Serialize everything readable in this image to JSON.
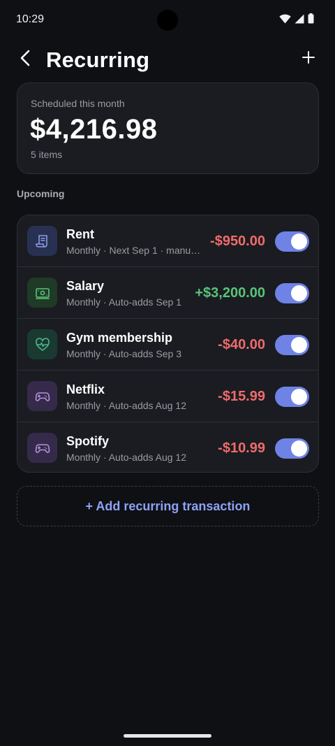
{
  "status_bar": {
    "time": "10:29"
  },
  "app_bar": {
    "title": "Recurring"
  },
  "summary": {
    "label": "Scheduled this month",
    "amount": "$4,216.98",
    "count": "5 items"
  },
  "section": {
    "heading": "Upcoming"
  },
  "items": [
    {
      "name": "Rent",
      "subtitle": "Monthly · Next Sep 1 · manu…",
      "amount": "-$950.00",
      "type": "expense",
      "icon": "receipt-icon",
      "icon_bg": "#283152",
      "icon_color": "#8a9ce8",
      "enabled": true
    },
    {
      "name": "Salary",
      "subtitle": "Monthly · Auto-adds Sep 1",
      "amount": "+$3,200.00",
      "type": "income",
      "icon": "banknote-icon",
      "icon_bg": "#1f3a26",
      "icon_color": "#59c47a",
      "enabled": true
    },
    {
      "name": "Gym membership",
      "subtitle": "Monthly · Auto-adds Sep 3",
      "amount": "-$40.00",
      "type": "expense",
      "icon": "heart-pulse-icon",
      "icon_bg": "#1a3a31",
      "icon_color": "#4fb58d",
      "enabled": true
    },
    {
      "name": "Netflix",
      "subtitle": "Monthly · Auto-adds Aug 12",
      "amount": "-$15.99",
      "type": "expense",
      "icon": "gamepad-icon",
      "icon_bg": "#362a4a",
      "icon_color": "#b394e0",
      "enabled": true
    },
    {
      "name": "Spotify",
      "subtitle": "Monthly · Auto-adds Aug 12",
      "amount": "-$10.99",
      "type": "expense",
      "icon": "gamepad-icon",
      "icon_bg": "#362a4a",
      "icon_color": "#b394e0",
      "enabled": true
    }
  ],
  "add_button": {
    "label": "+ Add recurring transaction"
  },
  "colors": {
    "background": "#0e1014",
    "card": "#1a1c21",
    "expense": "#ef6b6b",
    "income": "#59c47a",
    "accent": "#6f83e6",
    "link": "#8fa2f5"
  }
}
